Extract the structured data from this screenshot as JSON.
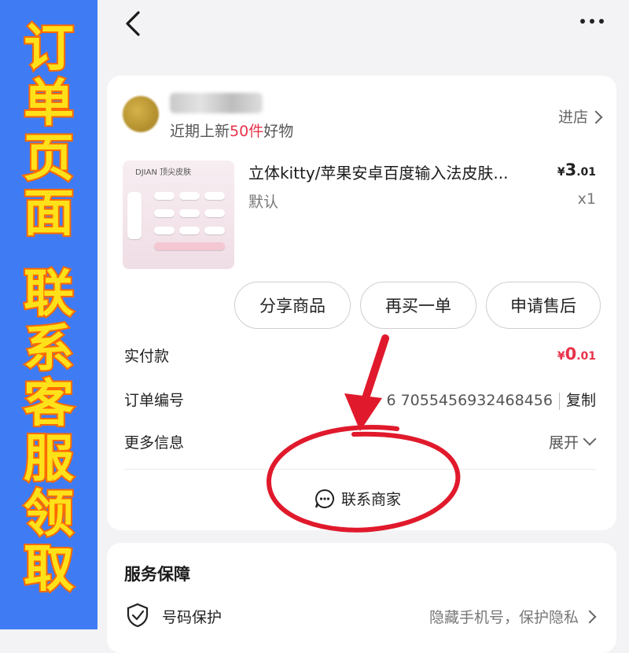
{
  "promo": {
    "top_chars": [
      "订",
      "单",
      "页",
      "面"
    ],
    "bottom_chars": [
      "联",
      "系",
      "客",
      "服",
      "领",
      "取"
    ]
  },
  "shop": {
    "subtitle_prefix": "近期上新",
    "subtitle_highlight": "50件",
    "subtitle_suffix": "好物",
    "enter_label": "进店"
  },
  "product": {
    "title": "立体kitty/苹果安卓百度输入法皮肤...",
    "spec": "默认",
    "price_symbol": "¥",
    "price_int": "3",
    "price_dec": ".01",
    "qty": "x1",
    "thumb_label": "DJIAN 顶尖皮肤"
  },
  "actions": {
    "share": "分享商品",
    "rebuy": "再买一单",
    "aftersale": "申请售后"
  },
  "rows": {
    "paid_label": "实付款",
    "paid_symbol": "¥",
    "paid_int": "0",
    "paid_dec": ".01",
    "order_label": "订单编号",
    "order_value": "6 7055456932468456",
    "copy_label": "复制",
    "more_label": "更多信息",
    "expand_label": "展开"
  },
  "contact": {
    "label": "联系商家"
  },
  "service": {
    "title": "服务保障",
    "phone_protect_label": "号码保护",
    "phone_protect_value": "隐藏手机号，保护隐私"
  },
  "colors": {
    "promo_strip": "#3f7cf4",
    "promo_text": "#ffe11a",
    "promo_outline": "#ff6a00",
    "price_red": "#e8324a",
    "annotation_red": "#e01a2c"
  }
}
